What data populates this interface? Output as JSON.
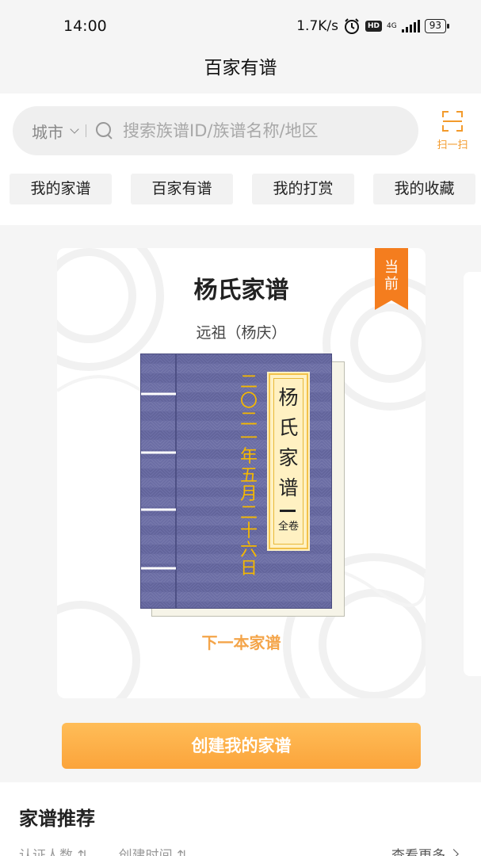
{
  "status_bar": {
    "time": "14:00",
    "net_speed": "1.7K/s",
    "hd": "HD",
    "network": "4G",
    "battery": "93"
  },
  "header": {
    "title": "百家有谱"
  },
  "search": {
    "city_label": "城市",
    "placeholder": "搜索族谱ID/族谱名称/地区",
    "scan_label": "扫一扫"
  },
  "tabs": [
    {
      "label": "我的家谱"
    },
    {
      "label": "百家有谱"
    },
    {
      "label": "我的打赏"
    },
    {
      "label": "我的收藏"
    }
  ],
  "card": {
    "title": "杨氏家谱",
    "subtitle": "远祖（杨庆）",
    "ribbon": "当前",
    "book_label_chars": "杨氏家谱",
    "book_label_small": "全卷",
    "book_date": "二〇二一年五月二十六日",
    "next_link": "下一本家谱"
  },
  "create_button": "创建我的家谱",
  "recommend": {
    "title": "家谱推荐",
    "sort_1": "认证人数 ⇅",
    "sort_2": "创建时间 ⇅",
    "more": "查看更多"
  },
  "colors": {
    "accent": "#f39a2b",
    "book_cover": "#6d6fa6",
    "date_text": "#f5b800"
  }
}
